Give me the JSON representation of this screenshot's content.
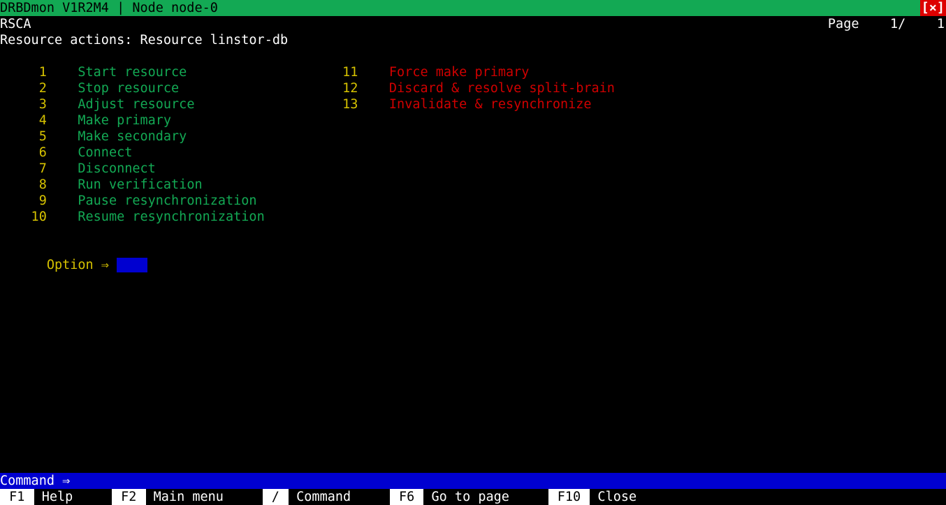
{
  "header": {
    "title_left": "DRBDmon V1R2M4 | Node node-0",
    "close": "[×]",
    "breadcrumb": "RSCA",
    "page_label": "Page    1/    1",
    "subtitle": "Resource actions: Resource linstor-db"
  },
  "menu": {
    "col1": [
      {
        "n": " 1",
        "label": "Start resource",
        "danger": false
      },
      {
        "n": " 2",
        "label": "Stop resource",
        "danger": false
      },
      {
        "n": " 3",
        "label": "Adjust resource",
        "danger": false
      },
      {
        "n": " 4",
        "label": "Make primary",
        "danger": false
      },
      {
        "n": " 5",
        "label": "Make secondary",
        "danger": false
      },
      {
        "n": " 6",
        "label": "Connect",
        "danger": false
      },
      {
        "n": " 7",
        "label": "Disconnect",
        "danger": false
      },
      {
        "n": " 8",
        "label": "Run verification",
        "danger": false
      },
      {
        "n": " 9",
        "label": "Pause resynchronization",
        "danger": false
      },
      {
        "n": "10",
        "label": "Resume resynchronization",
        "danger": false
      }
    ],
    "col2": [
      {
        "n": "11",
        "label": "Force make primary",
        "danger": true
      },
      {
        "n": "12",
        "label": "Discard & resolve split-brain",
        "danger": true
      },
      {
        "n": "13",
        "label": "Invalidate & resynchronize",
        "danger": true
      }
    ]
  },
  "option": {
    "label": "Option ⇒ ",
    "value": ""
  },
  "command": {
    "label": "Command ⇒ ",
    "value": ""
  },
  "fnkeys": [
    {
      "key": " F1 ",
      "label": " Help"
    },
    {
      "key": " F2 ",
      "label": " Main menu"
    },
    {
      "key": " / ",
      "label": " Command"
    },
    {
      "key": " F6 ",
      "label": " Go to page"
    },
    {
      "key": " F10 ",
      "label": " Close"
    }
  ]
}
